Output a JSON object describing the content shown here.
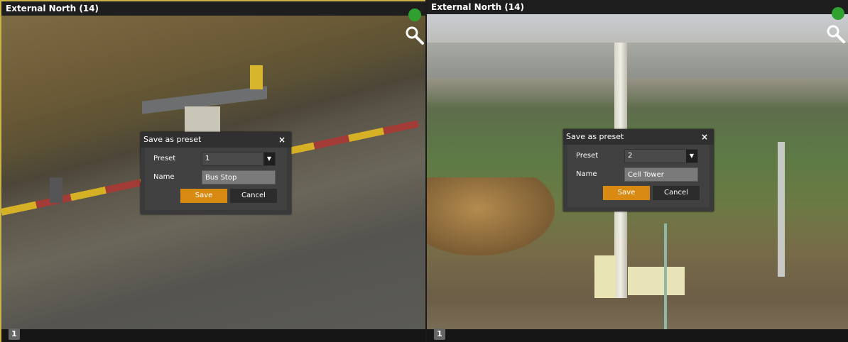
{
  "accent_color": "#d98a12",
  "status_color": "#2fa12f",
  "panes": [
    {
      "title": "External North (14)",
      "camera_number": "1",
      "icons": [
        "status-dot",
        "zoom-icon"
      ],
      "dialog": {
        "title": "Save as preset",
        "close_label": "×",
        "preset_label": "Preset",
        "preset_value": "1",
        "name_label": "Name",
        "name_value": "Bus Stop",
        "save_label": "Save",
        "cancel_label": "Cancel"
      }
    },
    {
      "title": "External North (14)",
      "camera_number": "1",
      "icons": [
        "status-dot",
        "zoom-icon"
      ],
      "dialog": {
        "title": "Save as preset",
        "close_label": "×",
        "preset_label": "Preset",
        "preset_value": "2",
        "name_label": "Name",
        "name_value": "Cell Tower",
        "save_label": "Save",
        "cancel_label": "Cancel"
      }
    }
  ]
}
